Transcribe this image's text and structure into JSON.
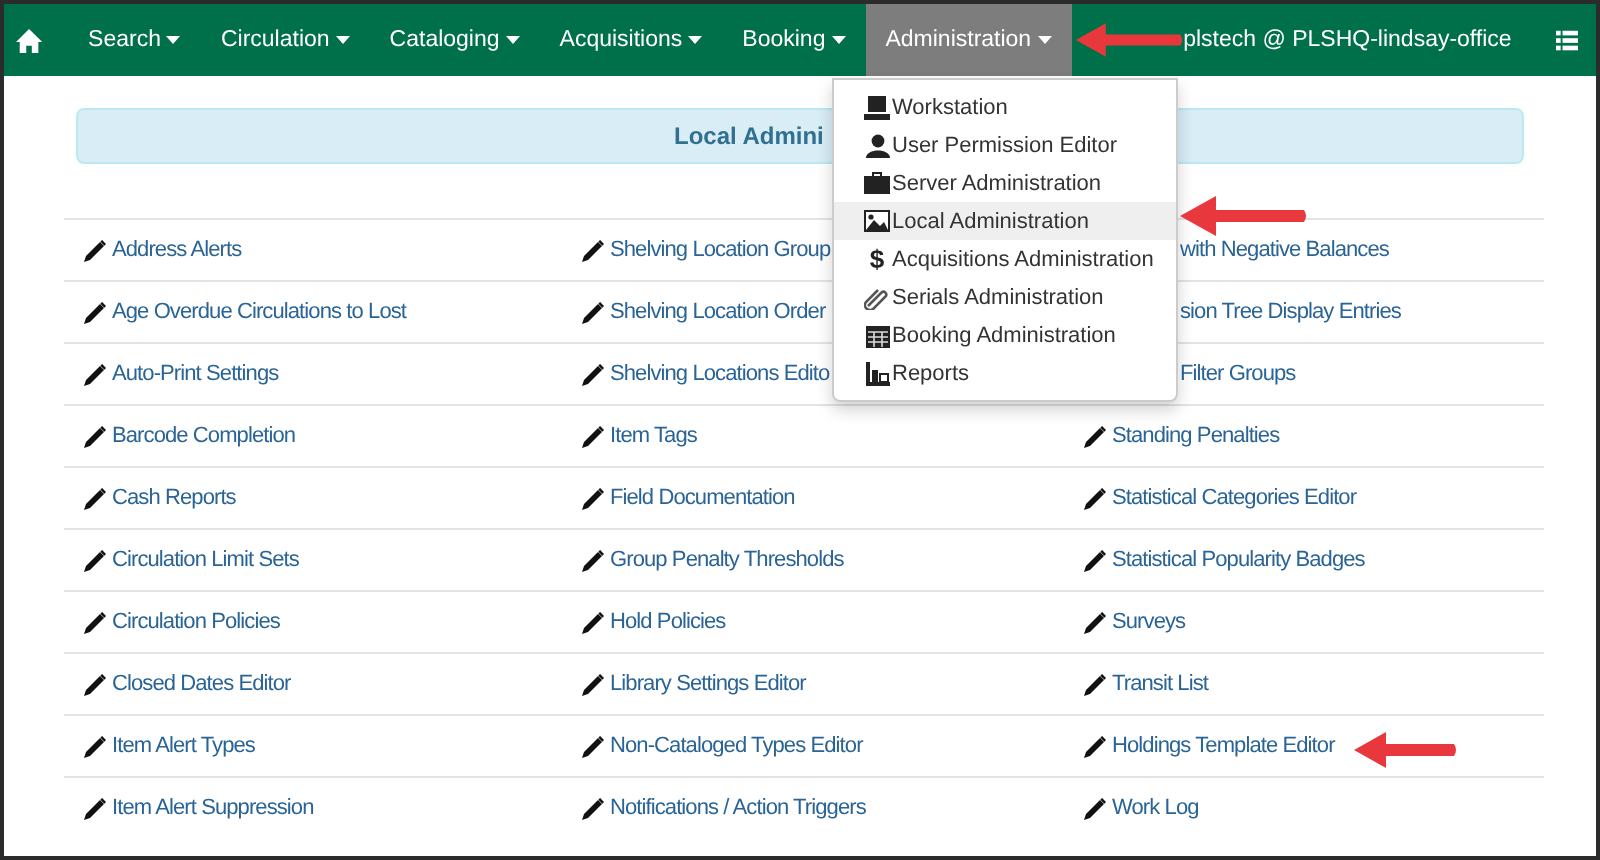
{
  "navbar": {
    "items": [
      {
        "label": "Search",
        "selected": false
      },
      {
        "label": "Circulation",
        "selected": false
      },
      {
        "label": "Cataloging",
        "selected": false
      },
      {
        "label": "Acquisitions",
        "selected": false
      },
      {
        "label": "Booking",
        "selected": false
      },
      {
        "label": "Administration",
        "selected": true
      }
    ],
    "user": "plstech @ PLSHQ-lindsay-office"
  },
  "admin_menu": [
    {
      "label": "Workstation",
      "kind": "laptop",
      "selected": false
    },
    {
      "label": "User Permission Editor",
      "kind": "user",
      "selected": false
    },
    {
      "label": "Server Administration",
      "kind": "briefcase",
      "selected": false
    },
    {
      "label": "Local Administration",
      "kind": "picture",
      "selected": true
    },
    {
      "label": "Acquisitions Administration",
      "kind": "glyph",
      "glyph": "$",
      "selected": false
    },
    {
      "label": "Serials Administration",
      "kind": "paperclip",
      "selected": false
    },
    {
      "label": "Booking Administration",
      "kind": "calendar",
      "selected": false
    },
    {
      "label": "Reports",
      "kind": "chart",
      "selected": false
    }
  ],
  "page_heading": "Local Admini",
  "links": [
    [
      {
        "text": "Address Alerts",
        "kind": "link"
      },
      {
        "text": "Shelving Location Group",
        "kind": "link"
      },
      {
        "text": "with Negative Balances",
        "kind": "clipped"
      }
    ],
    [
      {
        "text": "Age Overdue Circulations to Lost",
        "kind": "link"
      },
      {
        "text": "Shelving Location Order",
        "kind": "link"
      },
      {
        "text": "sion Tree Display Entries",
        "kind": "clipped"
      }
    ],
    [
      {
        "text": "Auto-Print Settings",
        "kind": "link"
      },
      {
        "text": "Shelving Locations Edito",
        "kind": "link"
      },
      {
        "text": "Filter Groups",
        "kind": "clipped"
      }
    ],
    [
      {
        "text": "Barcode Completion",
        "kind": "link"
      },
      {
        "text": "Item Tags",
        "kind": "link"
      },
      {
        "text": "Standing Penalties",
        "kind": "link"
      }
    ],
    [
      {
        "text": "Cash Reports",
        "kind": "link"
      },
      {
        "text": "Field Documentation",
        "kind": "link"
      },
      {
        "text": "Statistical Categories Editor",
        "kind": "link"
      }
    ],
    [
      {
        "text": "Circulation Limit Sets",
        "kind": "link"
      },
      {
        "text": "Group Penalty Thresholds",
        "kind": "link"
      },
      {
        "text": "Statistical Popularity Badges",
        "kind": "link"
      }
    ],
    [
      {
        "text": "Circulation Policies",
        "kind": "link"
      },
      {
        "text": "Hold Policies",
        "kind": "link"
      },
      {
        "text": "Surveys",
        "kind": "link"
      }
    ],
    [
      {
        "text": "Closed Dates Editor",
        "kind": "link"
      },
      {
        "text": "Library Settings Editor",
        "kind": "link"
      },
      {
        "text": "Transit List",
        "kind": "link"
      }
    ],
    [
      {
        "text": "Item Alert Types",
        "kind": "link"
      },
      {
        "text": "Non-Cataloged Types Editor",
        "kind": "link"
      },
      {
        "text": "Holdings Template Editor",
        "kind": "link"
      }
    ],
    [
      {
        "text": "Item Alert Suppression",
        "kind": "link"
      },
      {
        "text": "Notifications / Action Triggers",
        "kind": "link"
      },
      {
        "text": "Work Log",
        "kind": "link"
      }
    ]
  ]
}
